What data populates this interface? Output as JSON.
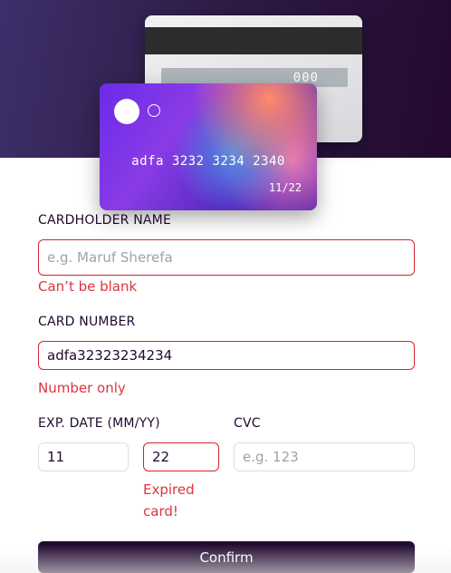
{
  "card_back": {
    "cvc": "000"
  },
  "card_front": {
    "number": "adfa 3232 3234 2340",
    "expiry": "11/22"
  },
  "form": {
    "cardholder": {
      "label": "CARDHOLDER NAME",
      "value": "",
      "placeholder": "e.g. Maruf Sherefa",
      "error": "Can’t be blank"
    },
    "card_number": {
      "label": "CARD NUMBER",
      "value": "adfa32323234234",
      "placeholder": "",
      "error": "Number only"
    },
    "exp_date": {
      "label": "EXP. DATE (MM/YY)",
      "month_value": "11",
      "year_value": "22",
      "error_line1": "Expired",
      "error_line2": "card!"
    },
    "cvc": {
      "label": "CVC",
      "value": "",
      "placeholder": "e.g. 123"
    }
  },
  "confirm_label": "Confirm",
  "colors": {
    "dark": "#21092f",
    "error": "#e0333f",
    "border": "#dfdee0"
  }
}
